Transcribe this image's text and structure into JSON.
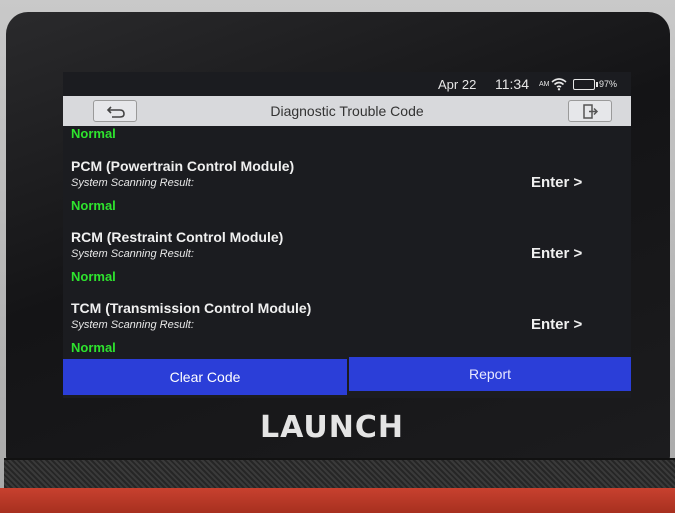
{
  "status_bar": {
    "date": "Apr 22",
    "time": "11:34",
    "am_pm": "AM",
    "battery": "97%"
  },
  "title_bar": {
    "title": "Diagnostic Trouble Code"
  },
  "previous_status": "Normal",
  "modules": [
    {
      "name": "PCM (Powertrain Control Module)",
      "subtitle": "System Scanning Result:",
      "status": "Normal",
      "enter_label": "Enter >"
    },
    {
      "name": "RCM (Restraint Control Module)",
      "subtitle": "System Scanning Result:",
      "status": "Normal",
      "enter_label": "Enter >"
    },
    {
      "name": "TCM (Transmission Control Module)",
      "subtitle": "System Scanning Result:",
      "status": "Normal",
      "enter_label": "Enter >"
    }
  ],
  "bottom_bar": {
    "clear_label": "Clear Code",
    "report_label": "Report"
  },
  "device": {
    "brand": "LAUNCH"
  },
  "colors": {
    "accent": "#2b3ed8",
    "status_ok": "#2ee32e",
    "title_bar": "#d8d9dc",
    "case": "#c8412f"
  },
  "icons": {
    "back": "back-arrow-icon",
    "exit": "exit-icon",
    "wifi": "wifi-icon",
    "battery": "battery-icon"
  }
}
